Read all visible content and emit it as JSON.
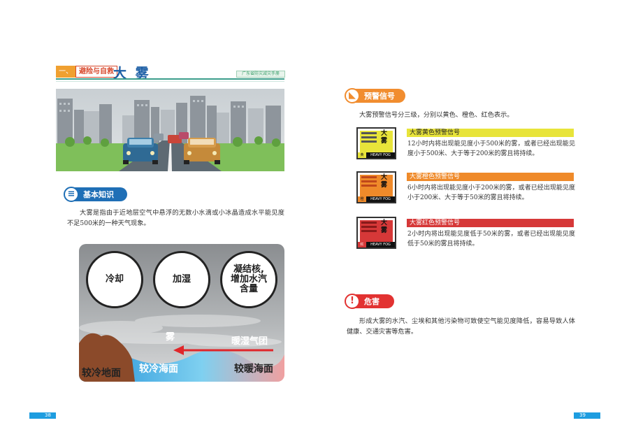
{
  "left": {
    "section_lead": "一、",
    "section_box": "避险与自救",
    "title": "大 雾",
    "manual_tag": "广东省防灾减灾手册",
    "basic_label": "基本知识",
    "basic_text": "大雾是指由于近地层空气中悬浮的无数小水滴或小冰晶造成水平能见度不足500米的一种天气现象。",
    "diagram": {
      "circle1": "冷却",
      "circle2": "加湿",
      "circle3": "凝结核,\n增加水汽\n含量",
      "fog": "雾",
      "warm_air": "暖湿气团",
      "cold_land": "较冷地面",
      "cold_sea": "较冷海面",
      "warm_sea": "较暖海面"
    },
    "page_number": "38"
  },
  "right": {
    "warning_label": "预警信号",
    "intro": "大雾预警信号分三级，分别以黄色、橙色、红色表示。",
    "signals": [
      {
        "glyph": "大雾",
        "level_char": "黄",
        "foot": "HEAVY FOG",
        "title": "大雾黄色预警信号",
        "text": "12小时内将出现能见度小于500米的雾，或者已经出现能见度小于500米、大于等于200米的雾且将持续。",
        "color": "#e8e43a",
        "bar_color": "#e8e43a"
      },
      {
        "glyph": "大雾",
        "level_char": "橙",
        "foot": "HEAVY FOG",
        "title": "大雾橙色预警信号",
        "text": "6小时内将出现能见度小于200米的雾，或者已经出现能见度小于200米、大于等于50米的雾且将持续。",
        "color": "#ef8a2a",
        "bar_color": "#e07a1e"
      },
      {
        "glyph": "大雾",
        "level_char": "红",
        "foot": "HEAVY FOG",
        "title": "大雾红色预警信号",
        "text": "2小时内将出现能见度低于50米的雾，或者已经出现能见度低于50米的雾且将持续。",
        "color": "#d63838",
        "bar_color": "#c02a2a"
      }
    ],
    "danger_label": "危害",
    "danger_text": "形成大雾的水汽、尘埃和其他污染物可致使空气能见度降低，容易导致人体健康、交通灾害等危害。",
    "page_number": "39"
  }
}
